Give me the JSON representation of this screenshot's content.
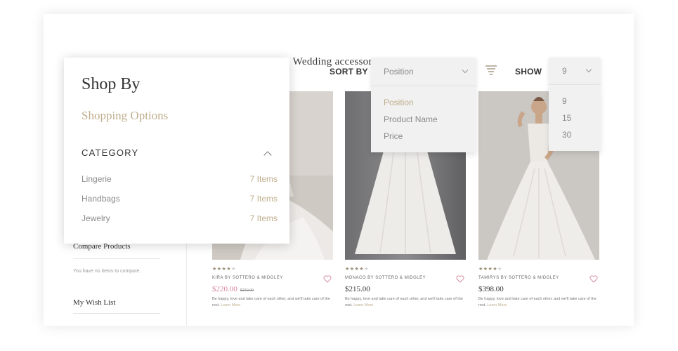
{
  "page": {
    "title": "Wedding accessories"
  },
  "toolbar": {
    "sort_label": "SORT BY",
    "sort_selected": "Position",
    "sort_options": [
      "Position",
      "Product Name",
      "Price"
    ],
    "show_label": "SHOW",
    "show_selected": "9",
    "show_options": [
      "9",
      "15",
      "30"
    ],
    "filter_icon": "filter-lines-icon"
  },
  "shop_by": {
    "title": "Shop By",
    "subtitle": "Shopping Options",
    "category_heading": "CATEGORY",
    "categories": [
      {
        "label": "Lingerie",
        "count": "7 Items"
      },
      {
        "label": "Handbags",
        "count": "7 Items"
      },
      {
        "label": "Jewelry",
        "count": "7 Items"
      }
    ]
  },
  "sidebar": {
    "compare_title": "Compare Products",
    "compare_empty": "You have no items to compare.",
    "wishlist_title": "My Wish List"
  },
  "products": [
    {
      "brand": "KIRA BY SOTTERO & MIDGLEY",
      "price": "$220.00",
      "old_price": "$250.00",
      "rating": 3.5,
      "desc": "Be happy, love and take care of each other, and we'll take care of the rest.",
      "more": "Learn More"
    },
    {
      "brand": "MONACO BY SOTTERO & MIDGLEY",
      "price": "$215.00",
      "rating": 4.5,
      "desc": "Be happy, love and take care of each other, and we'll take care of the rest.",
      "more": "Learn More"
    },
    {
      "brand": "TAMIRYS BY SOTTERO & MIDGLEY",
      "price": "$398.00",
      "rating": 3.5,
      "desc": "Be happy, love and take care of each other, and we'll take care of the rest.",
      "more": "Learn More"
    }
  ],
  "colors": {
    "accent_gold": "#bfae8c",
    "sale_pink": "#d4849a",
    "text_dark": "#333333",
    "muted": "#8a8a8a"
  }
}
